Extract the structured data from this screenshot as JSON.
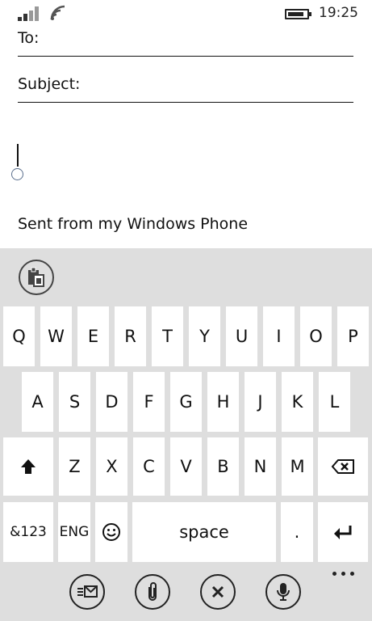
{
  "status": {
    "time": "19:25",
    "signal_icon": "signal-bars-icon",
    "wifi_icon": "wifi-icon",
    "battery_icon": "battery-icon",
    "battery_level": 0.85
  },
  "compose": {
    "to_label": "To:",
    "subject_label": "Subject:",
    "signature": "Sent from my Windows Phone"
  },
  "keyboard": {
    "clipboard_icon": "clipboard-icon",
    "row1": [
      "Q",
      "W",
      "E",
      "R",
      "T",
      "Y",
      "U",
      "I",
      "O",
      "P"
    ],
    "row2": [
      "A",
      "S",
      "D",
      "F",
      "G",
      "H",
      "J",
      "K",
      "L"
    ],
    "row3_letters": [
      "Z",
      "X",
      "C",
      "V",
      "B",
      "N",
      "M"
    ],
    "shift_icon": "shift-arrow-icon",
    "backspace_icon": "backspace-icon",
    "symbols_label": "&123",
    "language_label": "ENG",
    "emoji_icon": "smiley-icon",
    "space_label": "space",
    "period_label": ".",
    "enter_icon": "enter-icon"
  },
  "appbar": {
    "send_icon": "send-email-icon",
    "attach_icon": "paperclip-icon",
    "discard_icon": "close-icon",
    "dictate_icon": "microphone-icon",
    "more_icon": "more-dots-icon"
  }
}
